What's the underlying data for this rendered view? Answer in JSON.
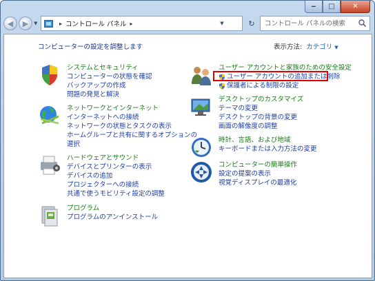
{
  "breadcrumb": [
    "コントロール パネル"
  ],
  "search": {
    "placeholder": "コントロール パネルの検索"
  },
  "heading": "コンピューターの設定を調整します",
  "view_by": {
    "label": "表示方法:",
    "value": "カテゴリ"
  },
  "categories": [
    {
      "icon": "system-security-icon",
      "title": "システムとセキュリティ",
      "links": [
        "コンピューターの状態を確認",
        "バックアップの作成",
        "問題の発見と解決"
      ]
    },
    {
      "icon": "network-internet-icon",
      "title": "ネットワークとインターネット",
      "links": [
        "インターネットへの接続",
        "ネットワークの状態とタスクの表示",
        "ホームグループと共有に関するオプションの",
        "選択"
      ]
    },
    {
      "icon": "hardware-sound-icon",
      "title": "ハードウェアとサウンド",
      "links": [
        "デバイスとプリンターの表示",
        "デバイスの追加",
        "プロジェクターへの接続",
        "共通で使うモビリティ設定の調整"
      ]
    },
    {
      "icon": "programs-icon",
      "title": "プログラム",
      "links": [
        "プログラムのアンインストール"
      ]
    },
    {
      "icon": "user-accounts-icon",
      "title": "ユーザー アカウントと家族のための安全設定",
      "links": [
        "ユーザー アカウントの追加または削除",
        "保護者による制限の設定"
      ]
    },
    {
      "icon": "appearance-icon",
      "title": "デスクトップのカスタマイズ",
      "links": [
        "テーマの変更",
        "デスクトップの背景の変更",
        "画面の解像度の調整"
      ]
    },
    {
      "icon": "clock-region-icon",
      "title": "時計、言語、および地域",
      "links": [
        "キーボードまたは入力方法の変更"
      ]
    },
    {
      "icon": "ease-of-access-icon",
      "title": "コンピューターの簡単操作",
      "links": [
        "設定の提案の表示",
        "視覚ディスプレイの最適化"
      ]
    }
  ]
}
